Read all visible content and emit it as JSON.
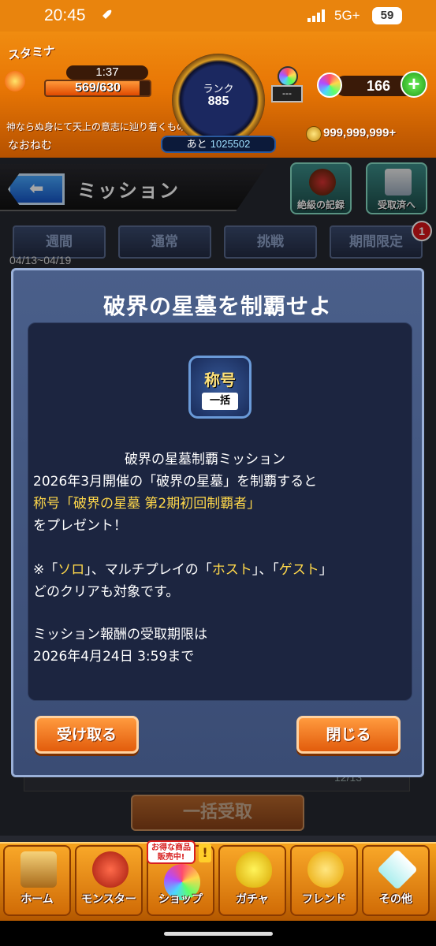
{
  "status_bar": {
    "time": "20:45",
    "network": "5G+",
    "battery": "59"
  },
  "header": {
    "stamina_label": "スタミナ",
    "stamina_timer": "1:37",
    "stamina_value": "569/630",
    "stamina_fraction": 0.903,
    "player_title": "神ならぬ身にて天上の意志に辿り着くもの",
    "player_name": "なおねむ",
    "rank_label": "ランク",
    "rank_value": "885",
    "rank_next_prefix": "あと",
    "rank_next_value": "1025502",
    "lamp_text": "---",
    "orb_count": "166",
    "coins": "999,999,999+"
  },
  "mission_header": {
    "title": "ミッション",
    "icon1_label": "絶級の記録",
    "icon2_label": "受取済へ"
  },
  "tabs": [
    {
      "label": "週間"
    },
    {
      "label": "通常"
    },
    {
      "label": "挑戦"
    },
    {
      "label": "期間限定"
    }
  ],
  "tab_badge": "1",
  "tab_date": "04/13~04/19",
  "under_count": "12/13",
  "bulk_button": "一括受取",
  "dialog": {
    "title": "破界の星墓を制覇せよ",
    "badge_top": "称号",
    "badge_bottom": "一括",
    "line1": "破界の星墓制覇ミッション",
    "line2": "2026年3月開催の「破界の星墓」を制覇すると",
    "line3": "称号「破界の星墓 第2期初回制覇者」",
    "line4": "をプレゼント！",
    "line5a": "※「",
    "line5b": "ソロ",
    "line5c": "」、マルチプレイの「",
    "line5d": "ホスト",
    "line5e": "」、「",
    "line5f": "ゲスト",
    "line5g": "」",
    "line6": "どのクリアも対象です。",
    "line7": "ミッション報酬の受取期限は",
    "line8": "2026年4月24日 3:59まで",
    "receive_button": "受け取る",
    "close_button": "閉じる"
  },
  "bottom_nav": {
    "items": [
      {
        "label": "ホーム"
      },
      {
        "label": "モンスター"
      },
      {
        "label": "ショップ"
      },
      {
        "label": "ガチャ"
      },
      {
        "label": "フレンド"
      },
      {
        "label": "その他"
      }
    ],
    "sale_tag": "お得な商品販売中!",
    "sale_excl": "!"
  }
}
